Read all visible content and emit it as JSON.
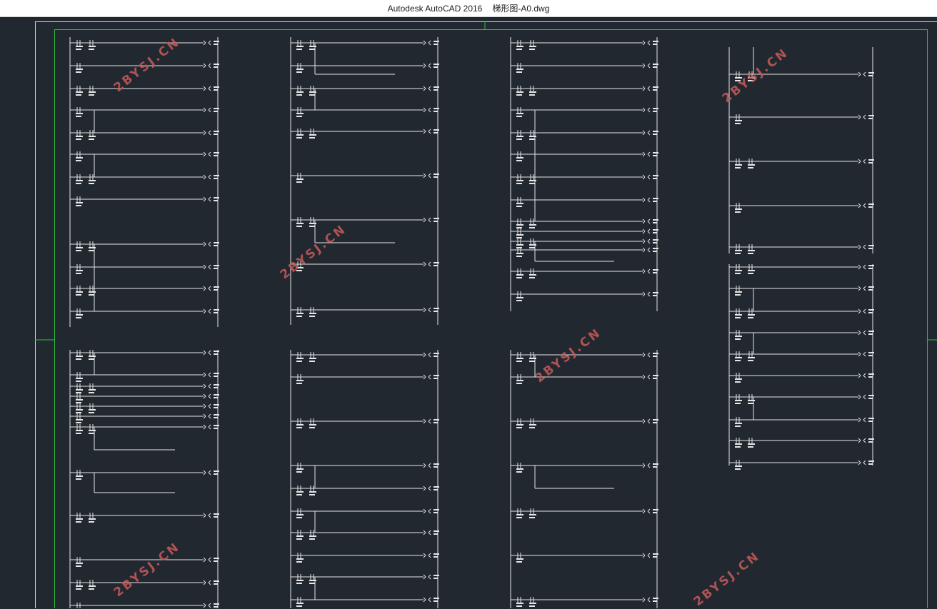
{
  "window": {
    "app_title": "Autodesk AutoCAD 2016",
    "file_name": "梯形图-A0.dwg"
  },
  "watermark_text": "2BYSJ.CN",
  "colors": {
    "canvas_bg": "#212830",
    "line": "#e6e6e6",
    "frame": "#d7d7d7",
    "viewport_border": "#2fbf3a",
    "watermark": "#c95a5a"
  }
}
